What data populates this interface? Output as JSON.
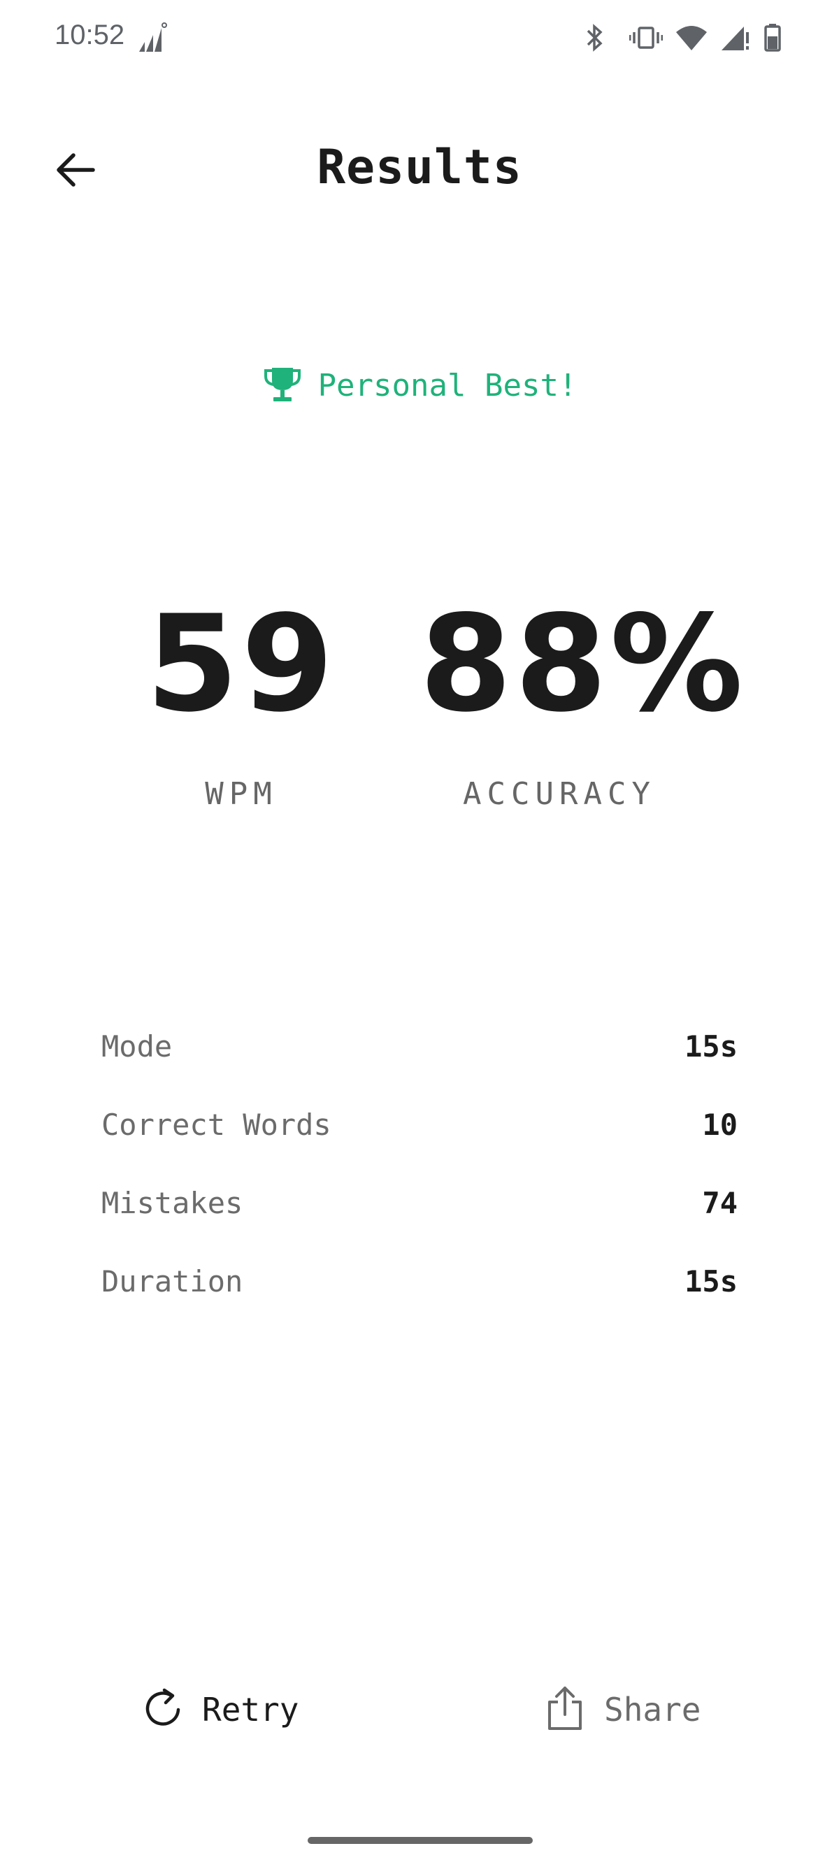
{
  "status_bar": {
    "time": "10:52",
    "icons": [
      "signal-data-icon",
      "bluetooth-icon",
      "vibrate-icon",
      "wifi-icon",
      "cell-signal-icon",
      "battery-icon"
    ]
  },
  "header": {
    "title": "Results",
    "back_icon": "arrow-left-icon"
  },
  "badge": {
    "icon": "trophy-icon",
    "text": "Personal Best!",
    "color": "#1fb27a"
  },
  "stats": {
    "wpm": {
      "value": "59",
      "label": "WPM"
    },
    "accuracy": {
      "value": "88%",
      "label": "ACCURACY"
    }
  },
  "details": [
    {
      "label": "Mode",
      "value": "15s"
    },
    {
      "label": "Correct Words",
      "value": "10"
    },
    {
      "label": "Mistakes",
      "value": "74"
    },
    {
      "label": "Duration",
      "value": "15s"
    }
  ],
  "actions": {
    "retry": {
      "label": "Retry",
      "icon": "refresh-icon"
    },
    "share": {
      "label": "Share",
      "icon": "share-icon"
    }
  }
}
